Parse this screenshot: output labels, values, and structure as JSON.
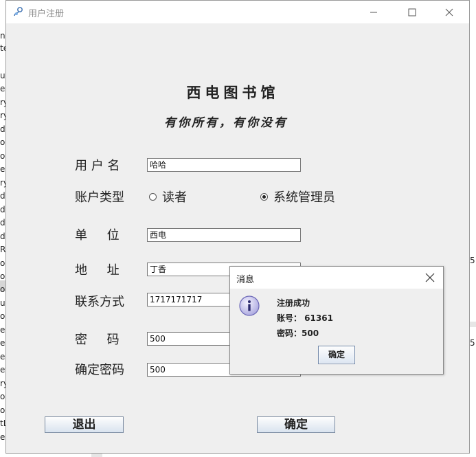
{
  "background": {
    "left_lines": [
      "na",
      "te",
      "",
      "u",
      "e",
      "ry",
      "ry",
      "dr",
      "oc",
      "or",
      "ea",
      "ry",
      "dc",
      "dr",
      "dr",
      "dr",
      "Re",
      "oc",
      "oc",
      "or",
      "un",
      "og",
      "ea",
      "ea",
      "eg",
      "et",
      "ry",
      "oc",
      "ol",
      "tL",
      "eç"
    ],
    "right_texts": [
      "5",
      "5"
    ]
  },
  "window": {
    "title": "用户注册",
    "heading_main": "西电图书馆",
    "heading_slogan": "有你所有，有你没有"
  },
  "form": {
    "username_label": "用 户 名",
    "username_value": "哈哈",
    "account_type_label": "账户类型",
    "radio_reader": "读者",
    "radio_admin": "系统管理员",
    "selected_radio": "系统管理员",
    "unit_label": "单     位",
    "unit_value": "西电",
    "address_label": "地     址",
    "address_value": "丁香",
    "contact_label": "联系方式",
    "contact_value": "1717171717",
    "password_label": "密     码",
    "password_value": "500",
    "confirm_label": "确定密码",
    "confirm_value": "500"
  },
  "buttons": {
    "exit": "退出",
    "confirm": "确定"
  },
  "dialog": {
    "title": "消息",
    "line1": "注册成功",
    "line2": "账号： 61361",
    "line3": "密码：500",
    "ok": "确定"
  }
}
